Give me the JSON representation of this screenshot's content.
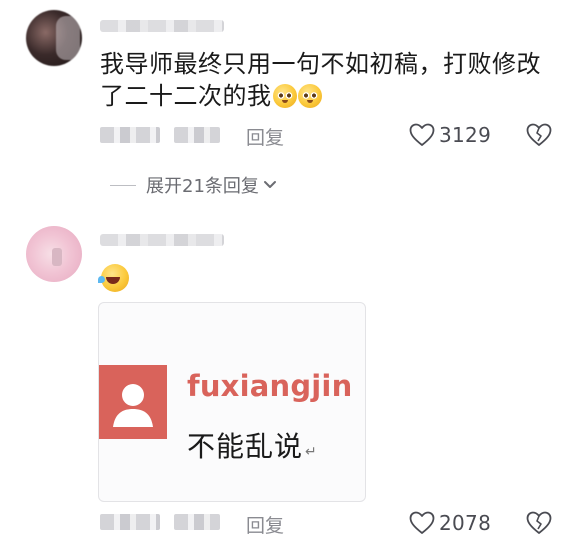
{
  "colors": {
    "background": "#ffffff",
    "text": "#1a1a1a",
    "meta": "#8a8b91",
    "card_accent": "#d9635b"
  },
  "comments": [
    {
      "text_line1": "我导师最终只用一句不如初稿，打败修改",
      "text_line2": "了二十二次的我",
      "emojis": [
        "pleading-face-icon",
        "pleading-face-icon"
      ],
      "reply_label": "回复",
      "like_count": "3129",
      "expand_label": "展开21条回复"
    },
    {
      "emojis": [
        "rolling-laughing-icon"
      ],
      "card": {
        "username": "fuxiangjin",
        "text": "不能乱说",
        "mark": "↵"
      },
      "reply_label": "回复",
      "like_count": "2078"
    }
  ]
}
